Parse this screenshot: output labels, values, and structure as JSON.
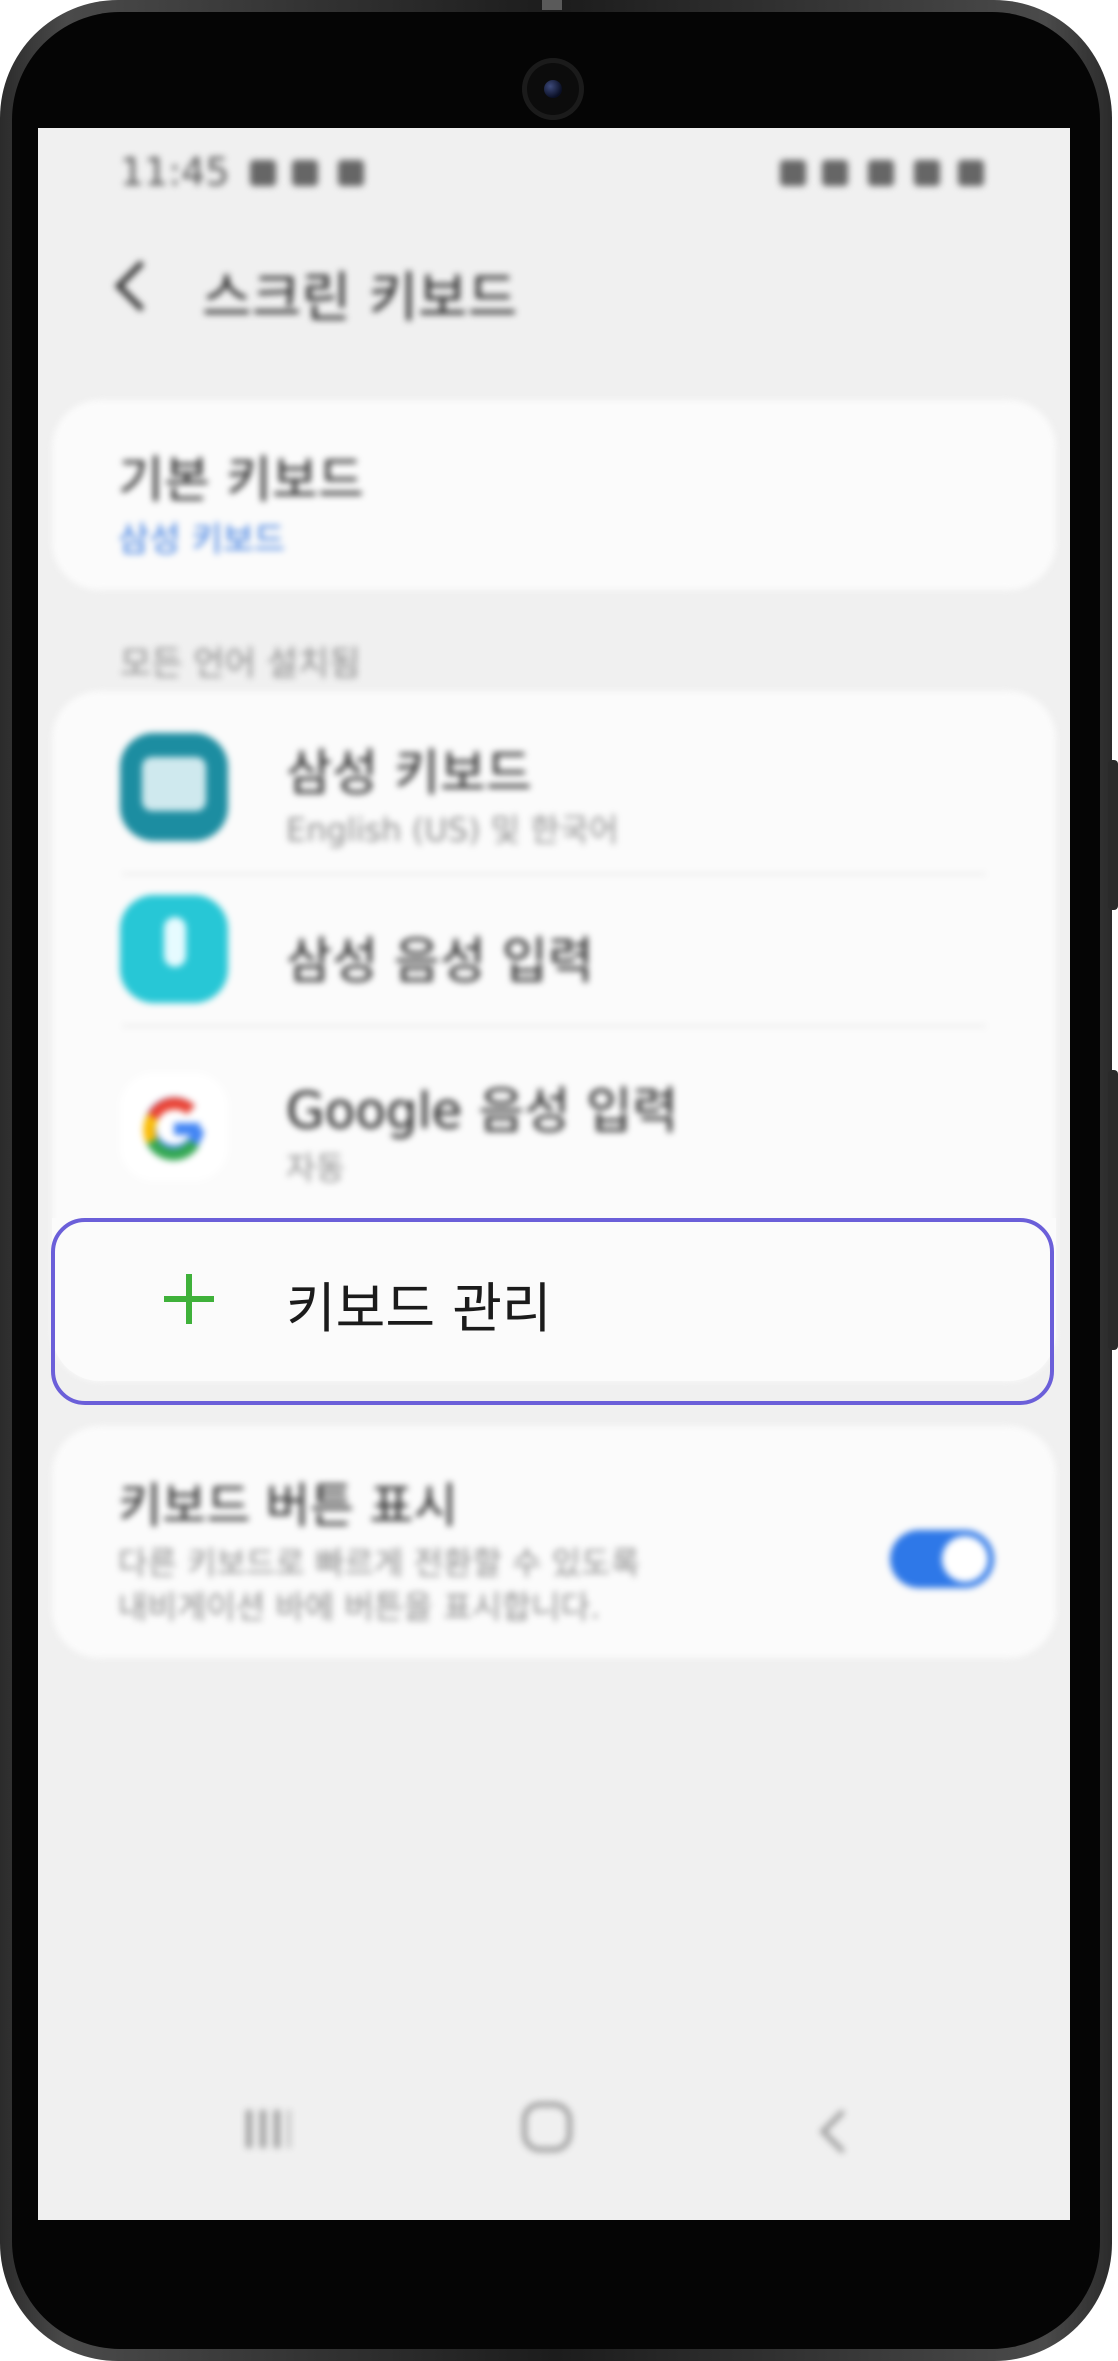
{
  "status_bar": {
    "time": "11:45"
  },
  "header": {
    "title": "스크린 키보드"
  },
  "default_keyboard": {
    "title": "기본 키보드",
    "value": "삼성 키보드"
  },
  "section_label": "모든 언어 설치됨",
  "keyboards": [
    {
      "name": "삼성 키보드",
      "subtitle": "English (US) 및 한국어",
      "icon": "samsung-keyboard-icon"
    },
    {
      "name": "삼성 음성 입력",
      "subtitle": "",
      "icon": "samsung-voice-input-icon"
    },
    {
      "name": "Google 음성 입력",
      "subtitle": "자동",
      "icon": "google-icon"
    }
  ],
  "manage": {
    "label": "키보드 관리",
    "icon": "plus-icon"
  },
  "keyboard_button": {
    "title": "키보드 버튼 표시",
    "desc_line1": "다른 키보드로 빠르게 전환할 수 있도록",
    "desc_line2": "내비게이션 바에 버튼을 표시합니다.",
    "toggle_on": true
  },
  "colors": {
    "accent": "#2e78e8",
    "highlight": "#6b5fd9",
    "plus": "#3fb13a",
    "link": "#3a7be0"
  }
}
